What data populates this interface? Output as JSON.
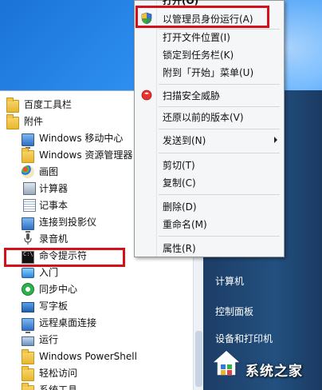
{
  "context_menu": {
    "items": [
      {
        "label": "打开(O)",
        "icon": "none"
      },
      {
        "label": "以管理员身份运行(A)",
        "icon": "uac-shield-icon"
      },
      {
        "label": "打开文件位置(I)",
        "icon": "none"
      },
      {
        "label": "锁定到任务栏(K)",
        "icon": "none"
      },
      {
        "label": "附到「开始」菜单(U)",
        "icon": "none"
      },
      {
        "label": "扫描安全威胁",
        "icon": "security-scan-icon"
      },
      {
        "label": "还原以前的版本(V)",
        "icon": "none"
      },
      {
        "label": "发送到(N)",
        "icon": "none",
        "submenu": true
      },
      {
        "label": "剪切(T)",
        "icon": "none"
      },
      {
        "label": "复制(C)",
        "icon": "none"
      },
      {
        "label": "删除(D)",
        "icon": "none"
      },
      {
        "label": "重命名(M)",
        "icon": "none"
      },
      {
        "label": "属性(R)",
        "icon": "none"
      }
    ]
  },
  "programs": {
    "items": [
      {
        "label": "百度工具栏",
        "icon": "folder-icon",
        "level": 0
      },
      {
        "label": "附件",
        "icon": "folder-icon",
        "level": 0
      },
      {
        "label": "Windows 移动中心",
        "icon": "mobility-center-icon",
        "level": 1
      },
      {
        "label": "Windows 资源管理器",
        "icon": "explorer-icon",
        "level": 1
      },
      {
        "label": "画图",
        "icon": "paint-icon",
        "level": 1
      },
      {
        "label": "计算器",
        "icon": "calculator-icon",
        "level": 1
      },
      {
        "label": "记事本",
        "icon": "notepad-icon",
        "level": 1
      },
      {
        "label": "连接到投影仪",
        "icon": "projector-icon",
        "level": 1
      },
      {
        "label": "录音机",
        "icon": "microphone-icon",
        "level": 1
      },
      {
        "label": "命令提示符",
        "icon": "command-prompt-icon",
        "level": 1
      },
      {
        "label": "入门",
        "icon": "getting-started-icon",
        "level": 1
      },
      {
        "label": "同步中心",
        "icon": "sync-center-icon",
        "level": 1
      },
      {
        "label": "写字板",
        "icon": "wordpad-icon",
        "level": 1
      },
      {
        "label": "远程桌面连接",
        "icon": "remote-desktop-icon",
        "level": 1
      },
      {
        "label": "运行",
        "icon": "run-icon",
        "level": 1
      },
      {
        "label": "Windows PowerShell",
        "icon": "folder-icon",
        "level": 1
      },
      {
        "label": "轻松访问",
        "icon": "folder-icon",
        "level": 1
      },
      {
        "label": "系统工具",
        "icon": "folder-icon",
        "level": 1
      }
    ]
  },
  "right_panel": {
    "items": [
      "计算机",
      "控制面板",
      "设备和打印机"
    ]
  },
  "watermark": {
    "text": "系统之家"
  },
  "colors": {
    "highlight": "#d4101a",
    "right_panel": "#23507f",
    "desktop": "#2d8ef0"
  }
}
